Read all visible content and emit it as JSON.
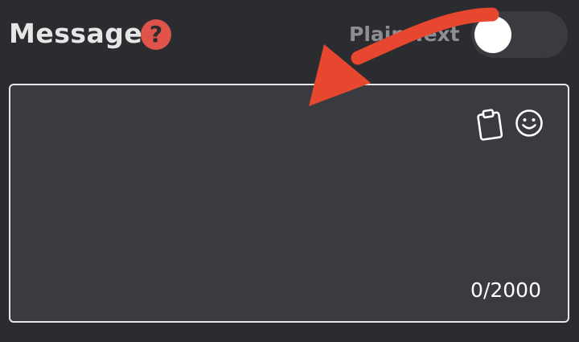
{
  "header": {
    "title": "Message",
    "help_icon_glyph": "?",
    "help_icon": "question-circle-icon"
  },
  "toggle": {
    "label": "Plain Text",
    "state": "off"
  },
  "editor": {
    "value": "",
    "counter": "0/2000",
    "icons": [
      "clipboard-icon",
      "emoji-icon"
    ]
  },
  "annotation": {
    "type": "arrow",
    "color": "#e8472f"
  },
  "colors": {
    "background": "#2b2c30",
    "panel": "#3a3b40",
    "help": "#e0534a",
    "arrow": "#e8472f"
  }
}
